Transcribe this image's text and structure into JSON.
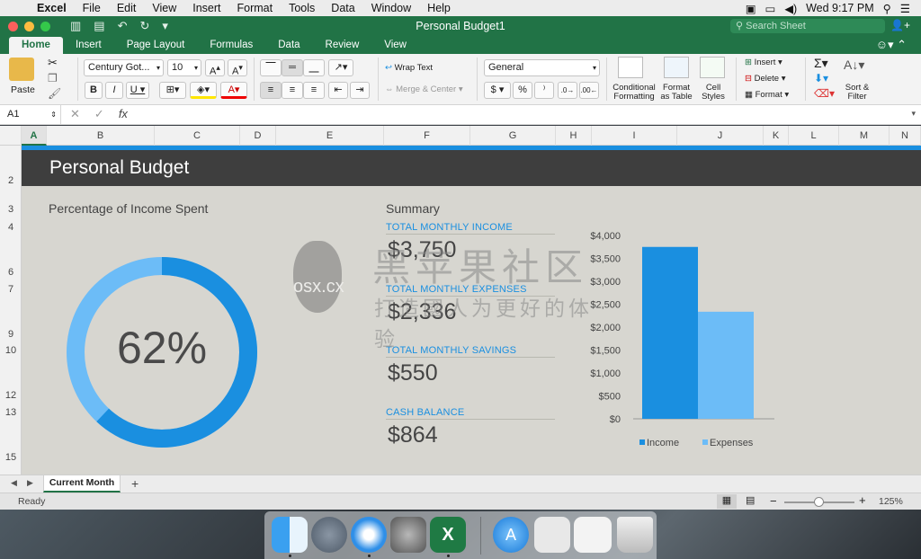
{
  "menubar": {
    "app_name": "Excel",
    "items": [
      "File",
      "Edit",
      "View",
      "Insert",
      "Format",
      "Tools",
      "Data",
      "Window",
      "Help"
    ],
    "clock": "Wed 9:17 PM"
  },
  "window": {
    "title": "Personal Budget1",
    "search_placeholder": "Search Sheet"
  },
  "ribbon_tabs": [
    "Home",
    "Insert",
    "Page Layout",
    "Formulas",
    "Data",
    "Review",
    "View"
  ],
  "ribbon": {
    "paste": "Paste",
    "font_name": "Century Got...",
    "font_size": "10",
    "wrap_text": "Wrap Text",
    "merge_center": "Merge & Center",
    "number_format": "General",
    "conditional_formatting": "Conditional Formatting",
    "format_as_table": "Format as Table",
    "cell_styles": "Cell Styles",
    "insert": "Insert",
    "delete": "Delete",
    "format": "Format",
    "sort_filter": "Sort & Filter"
  },
  "formula_bar": {
    "cell_ref": "A1",
    "fx": "fx"
  },
  "columns": [
    "A",
    "B",
    "C",
    "D",
    "E",
    "F",
    "G",
    "H",
    "I",
    "J",
    "K",
    "L",
    "M",
    "N"
  ],
  "rows": [
    "2",
    "3",
    "4",
    "6",
    "7",
    "9",
    "10",
    "12",
    "13",
    "15"
  ],
  "sheet": {
    "banner_title": "Personal Budget",
    "donut_heading": "Percentage of Income Spent",
    "donut_value": "62%",
    "donut_fraction": 0.62,
    "summary_heading": "Summary",
    "items": [
      {
        "label": "TOTAL MONTHLY INCOME",
        "value": "$3,750"
      },
      {
        "label": "TOTAL MONTHLY EXPENSES",
        "value": "$2,336"
      },
      {
        "label": "TOTAL MONTHLY SAVINGS",
        "value": "$550"
      },
      {
        "label": "CASH BALANCE",
        "value": "$864"
      }
    ]
  },
  "chart_data": {
    "type": "bar",
    "categories": [
      ""
    ],
    "series": [
      {
        "name": "Income",
        "values": [
          3750
        ],
        "color": "#1a8fe0"
      },
      {
        "name": "Expenses",
        "values": [
          2336
        ],
        "color": "#6cbcf7"
      }
    ],
    "ylim": [
      0,
      4000
    ],
    "yticks": [
      "$0",
      "$500",
      "$1,000",
      "$1,500",
      "$2,000",
      "$2,500",
      "$3,000",
      "$3,500",
      "$4,000"
    ],
    "legend": "bottom"
  },
  "sheet_tabs": {
    "active": "Current Month",
    "add": "+"
  },
  "status": {
    "text": "Ready",
    "zoom": "125%",
    "zoom_fraction": 0.5
  },
  "watermark": {
    "brand_cn": "黑苹果社区",
    "brand_site": "OSX.CX",
    "slogan": "打造國人为更好的体验"
  },
  "colors": {
    "excel_green": "#217346",
    "accent_blue": "#1a8fe0",
    "light_blue": "#6cbcf7"
  }
}
